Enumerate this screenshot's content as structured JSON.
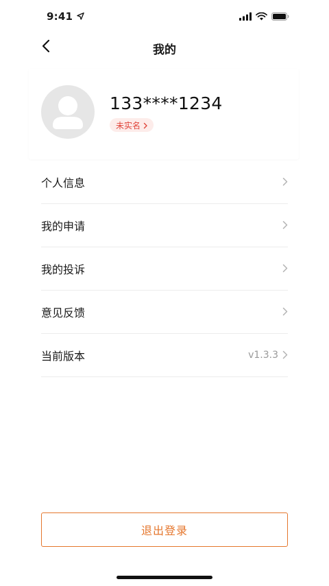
{
  "status_bar": {
    "time": "9:41",
    "icons": [
      "location-arrow-icon",
      "cellular-signal-icon",
      "wifi-icon",
      "battery-icon"
    ]
  },
  "nav": {
    "title": "我的",
    "back_icon": "chevron-left-icon"
  },
  "profile": {
    "avatar_icon": "user-avatar-icon",
    "phone": "133****1234",
    "verify_status": "未实名"
  },
  "menu": {
    "items": [
      {
        "label": "个人信息",
        "value": ""
      },
      {
        "label": "我的申请",
        "value": ""
      },
      {
        "label": "我的投诉",
        "value": ""
      },
      {
        "label": "意见反馈",
        "value": ""
      },
      {
        "label": "当前版本",
        "value": "v1.3.3"
      }
    ],
    "chevron_icon": "chevron-right-icon"
  },
  "logout": {
    "label": "退出登录"
  },
  "colors": {
    "accent": "#e5762c",
    "badge_text": "#e0443a",
    "badge_bg": "#fdecea",
    "avatar_bg": "#e6e6e6"
  }
}
